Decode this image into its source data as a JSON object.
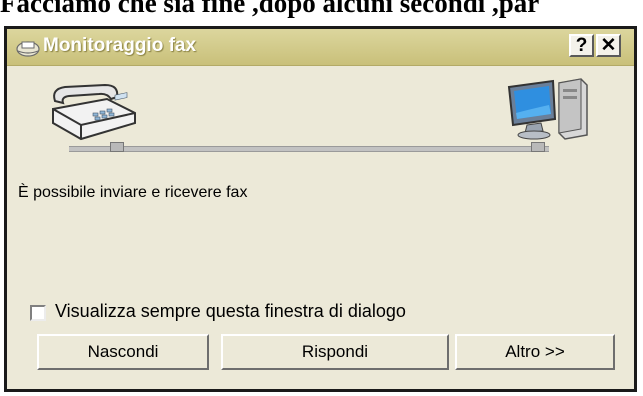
{
  "document": {
    "overflow_text": "Facciamo che sia fine ,dopo alcuni secondi ,par"
  },
  "window": {
    "title": "Monitoraggio fax",
    "help_label": "?",
    "close_label": "✕"
  },
  "icons": {
    "title": "fax-monitor-icon",
    "fax": "fax-machine-icon",
    "computer": "computer-icon"
  },
  "status": {
    "message": "È possibile inviare e ricevere fax"
  },
  "options": {
    "always_show_label": "Visualizza sempre questa finestra di dialogo",
    "always_show_checked": false
  },
  "buttons": {
    "hide": "Nascondi",
    "answer": "Rispondi",
    "more": "Altro >>"
  },
  "colors": {
    "dialog_bg": "#ece9d8",
    "titlebar": "#c9c07a"
  }
}
